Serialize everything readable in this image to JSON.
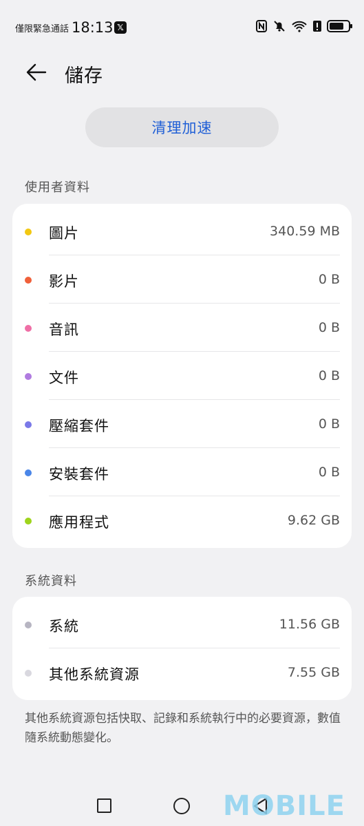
{
  "status_bar": {
    "carrier": "僅限緊急通話",
    "time": "18:13",
    "x_badge": "𝕏",
    "icons": [
      "nfc-icon",
      "mute-bell-icon",
      "wifi-icon",
      "alert-icon",
      "battery-icon"
    ],
    "battery_level": 0.75
  },
  "header": {
    "title": "儲存"
  },
  "clean_button": {
    "label": "清理加速"
  },
  "user_data": {
    "section_title": "使用者資料",
    "items": [
      {
        "label": "圖片",
        "value": "340.59 MB",
        "color": "#f2c812"
      },
      {
        "label": "影片",
        "value": "0 B",
        "color": "#f0603a"
      },
      {
        "label": "音訊",
        "value": "0 B",
        "color": "#ef6fa6"
      },
      {
        "label": "文件",
        "value": "0 B",
        "color": "#b07be0"
      },
      {
        "label": "壓縮套件",
        "value": "0 B",
        "color": "#7a79e8"
      },
      {
        "label": "安裝套件",
        "value": "0 B",
        "color": "#4a86e8"
      },
      {
        "label": "應用程式",
        "value": "9.62 GB",
        "color": "#9ed41c"
      }
    ]
  },
  "system_data": {
    "section_title": "系統資料",
    "items": [
      {
        "label": "系統",
        "value": "11.56 GB",
        "color": "#b7b5c2"
      },
      {
        "label": "其他系統資源",
        "value": "7.55 GB",
        "color": "#d9d8df"
      }
    ]
  },
  "footnote": "其他系統資源包括快取、記錄和系統執行中的必要資源，數值隨系統動態變化。",
  "watermark": "MOBILE"
}
